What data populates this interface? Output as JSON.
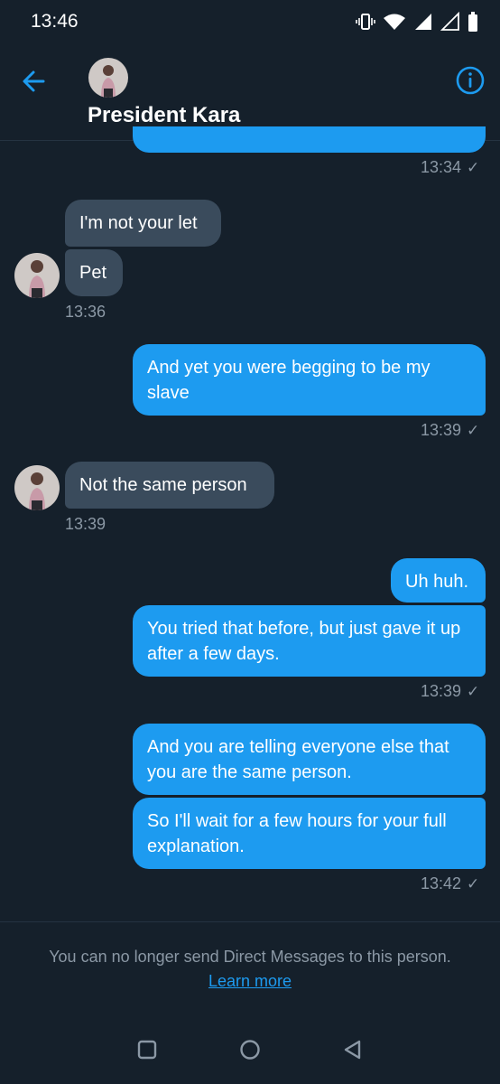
{
  "status_bar": {
    "time": "13:46"
  },
  "header": {
    "name": "President Kara"
  },
  "messages": [
    {
      "text": "",
      "time": "13:34"
    },
    {
      "text": "I'm not your let"
    },
    {
      "text": "Pet",
      "time": "13:36"
    },
    {
      "text": "And yet you were begging to be my slave",
      "time": "13:39"
    },
    {
      "text": "Not the same person",
      "time": "13:39"
    },
    {
      "text": "Uh huh."
    },
    {
      "text": "You tried that before, but just gave it up after a few days.",
      "time": "13:39"
    },
    {
      "text": "And you are telling everyone else that you are the same person."
    },
    {
      "text": "So I'll wait for a few hours for your full explanation.",
      "time": "13:42"
    }
  ],
  "footer": {
    "notice": "You can no longer send Direct Messages to this person.",
    "link": "Learn more"
  },
  "colors": {
    "background": "#15202b",
    "outgoing": "#1d9bf0",
    "incoming": "#3a4b5c",
    "muted": "#8b98a5"
  },
  "icons": [
    "vibrate-icon",
    "wifi-icon",
    "signal-icon",
    "battery-icon",
    "back-arrow-icon",
    "info-icon",
    "check-icon",
    "recents-icon",
    "home-icon",
    "back-triangle-icon"
  ]
}
